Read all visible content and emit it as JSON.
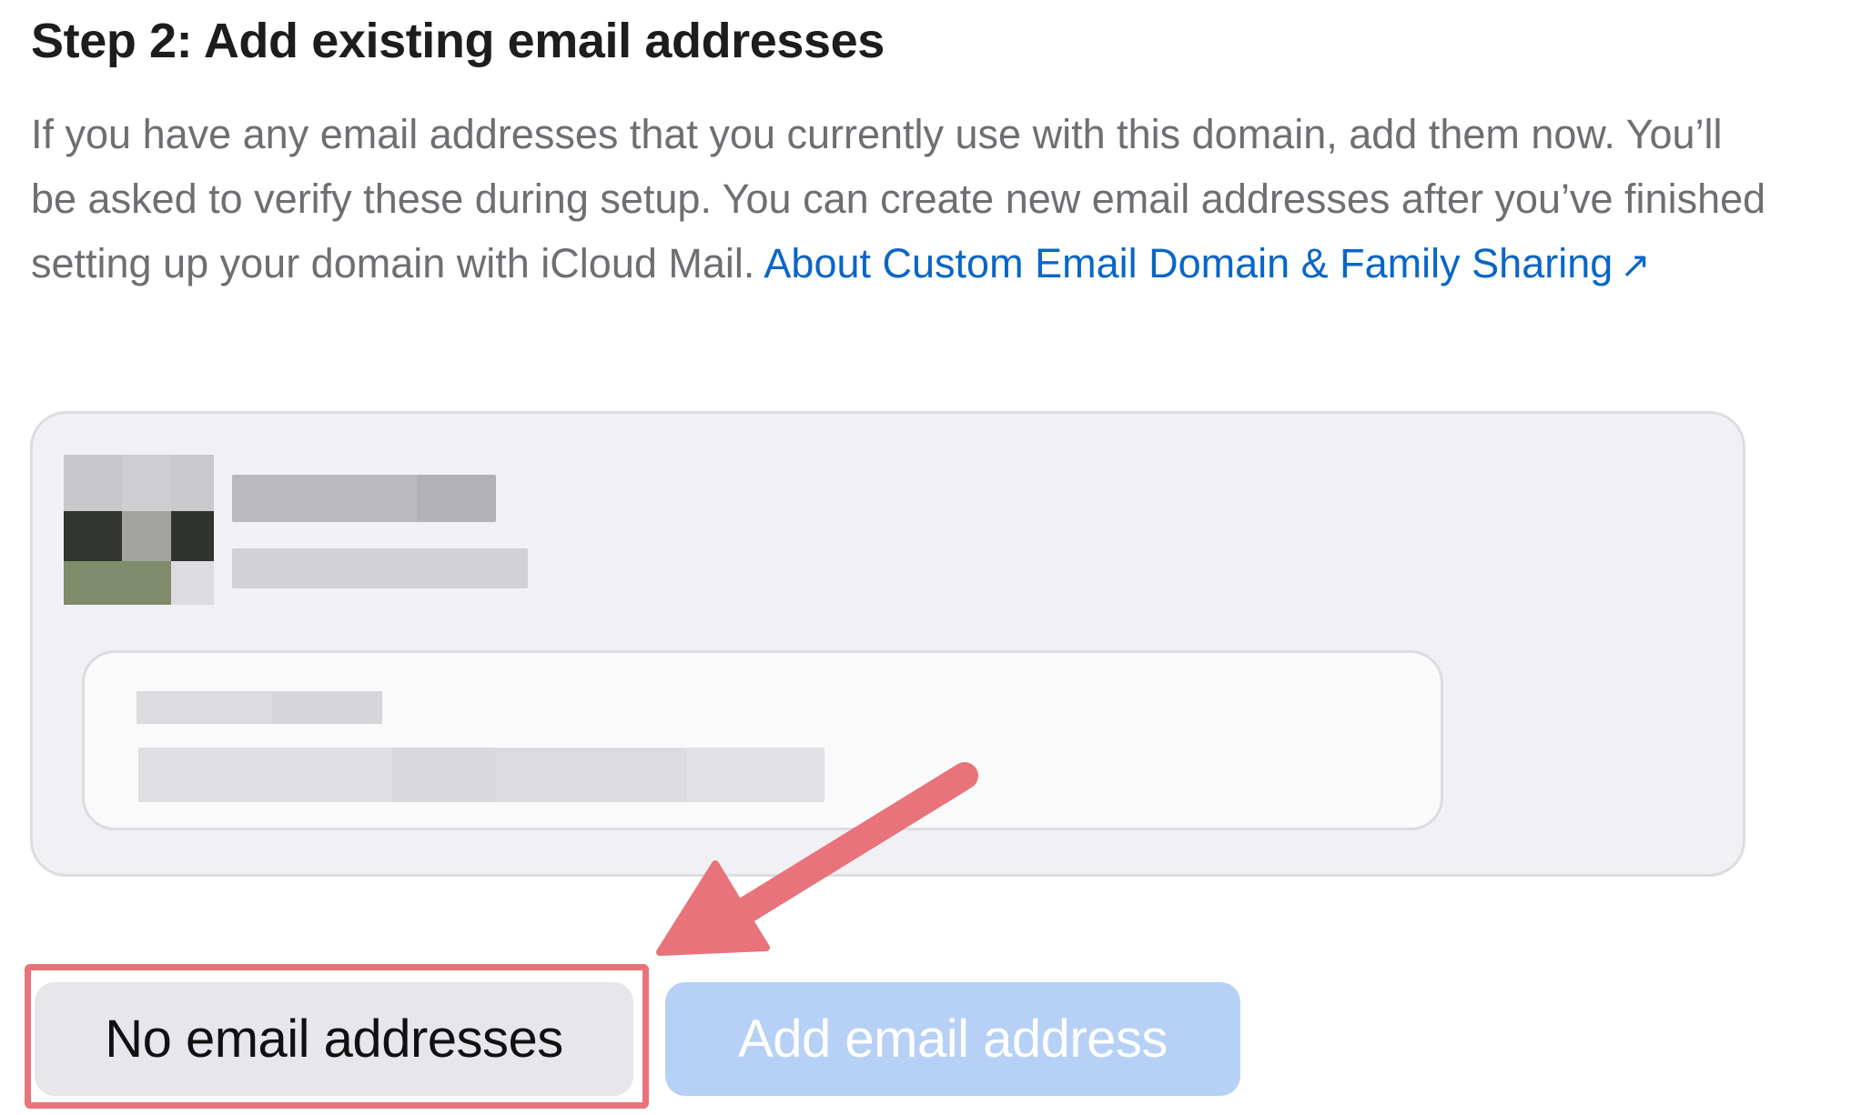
{
  "step": {
    "title": "Step 2: Add existing email addresses",
    "description_text": "If you have any email addresses that you currently use with this domain, add them now. You’ll be asked to verify these during setup. You can create new email addresses after you’ve finished setting up your domain with iCloud Mail.",
    "learn_more_link": "About Custom Email Domain & Family Sharing",
    "external_link_glyph": "↗"
  },
  "buttons": {
    "no_email": "No email addresses",
    "add_email": "Add email address"
  },
  "colors": {
    "link": "#0a66c8",
    "annotation": "#e8737a",
    "primary_disabled": "#b6d1f5"
  },
  "icons": {
    "avatar": "pixelated-avatar-image",
    "annotation_arrow": "arrow-pointing-down-left",
    "external_link": "external-link-icon"
  }
}
